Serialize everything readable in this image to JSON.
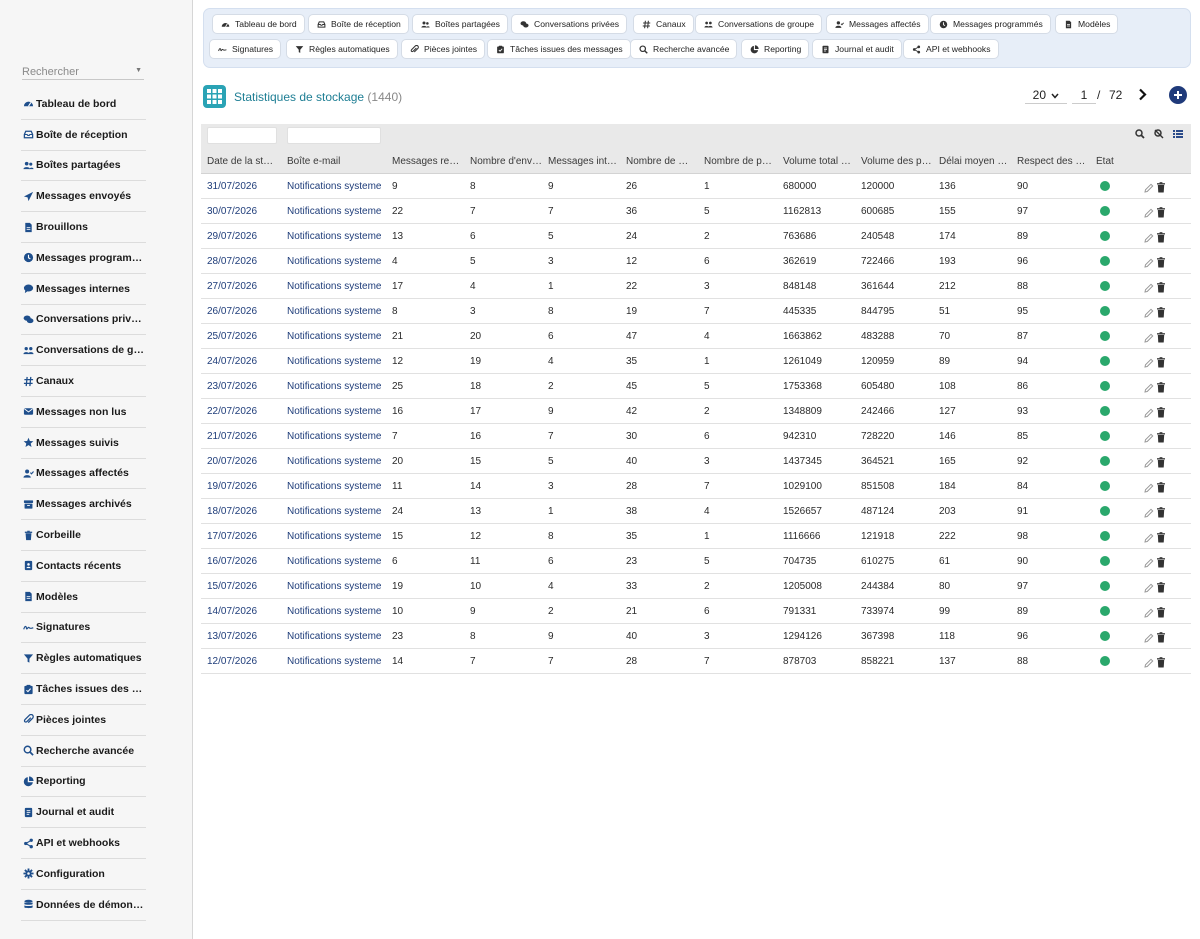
{
  "sidebar": {
    "search_placeholder": "Rechercher",
    "items": [
      {
        "label": "Tableau de bord",
        "icon": "dashboard-icon"
      },
      {
        "label": "Boîte de réception",
        "icon": "inbox-icon"
      },
      {
        "label": "Boîtes partagées",
        "icon": "users-icon"
      },
      {
        "label": "Messages envoyés",
        "icon": "send-icon"
      },
      {
        "label": "Brouillons",
        "icon": "file-icon"
      },
      {
        "label": "Messages programmés",
        "icon": "clock-icon"
      },
      {
        "label": "Messages internes",
        "icon": "comment-icon"
      },
      {
        "label": "Conversations privées",
        "icon": "comments-icon"
      },
      {
        "label": "Conversations de groupe",
        "icon": "group-icon"
      },
      {
        "label": "Canaux",
        "icon": "hash-icon"
      },
      {
        "label": "Messages non lus",
        "icon": "envelope-icon"
      },
      {
        "label": "Messages suivis",
        "icon": "star-icon"
      },
      {
        "label": "Messages affectés",
        "icon": "user-check-icon"
      },
      {
        "label": "Messages archivés",
        "icon": "archive-icon"
      },
      {
        "label": "Corbeille",
        "icon": "trash-icon"
      },
      {
        "label": "Contacts récents",
        "icon": "contact-icon"
      },
      {
        "label": "Modèles",
        "icon": "file-icon"
      },
      {
        "label": "Signatures",
        "icon": "signature-icon"
      },
      {
        "label": "Règles automatiques",
        "icon": "filter-icon"
      },
      {
        "label": "Tâches issues des messages",
        "icon": "tasks-icon"
      },
      {
        "label": "Pièces jointes",
        "icon": "paperclip-icon"
      },
      {
        "label": "Recherche avancée",
        "icon": "search-icon"
      },
      {
        "label": "Reporting",
        "icon": "pie-chart-icon"
      },
      {
        "label": "Journal et audit",
        "icon": "journal-icon"
      },
      {
        "label": "API et webhooks",
        "icon": "share-icon"
      },
      {
        "label": "Configuration",
        "icon": "gear-icon"
      },
      {
        "label": "Données de démonstration",
        "icon": "database-icon"
      }
    ]
  },
  "topbar": {
    "chips": [
      {
        "label": "Tableau de bord",
        "icon": "dashboard-icon"
      },
      {
        "label": "Boîte de réception",
        "icon": "inbox-icon"
      },
      {
        "label": "Boîtes partagées",
        "icon": "users-icon"
      },
      {
        "label": "Conversations privées",
        "icon": "comments-icon"
      },
      {
        "label": "Canaux",
        "icon": "hash-icon"
      },
      {
        "label": "Conversations de groupe",
        "icon": "group-icon"
      },
      {
        "label": "Messages affectés",
        "icon": "user-check-icon"
      },
      {
        "label": "Messages programmés",
        "icon": "clock-icon"
      },
      {
        "label": "Modèles",
        "icon": "file-icon"
      },
      {
        "label": "Signatures",
        "icon": "signature-icon"
      },
      {
        "label": "Règles automatiques",
        "icon": "filter-icon"
      },
      {
        "label": "Pièces jointes",
        "icon": "paperclip-icon"
      },
      {
        "label": "Tâches issues des messages",
        "icon": "tasks-icon"
      },
      {
        "label": "Recherche avancée",
        "icon": "search-icon"
      },
      {
        "label": "Reporting",
        "icon": "pie-chart-icon"
      },
      {
        "label": "Journal et audit",
        "icon": "journal-icon"
      },
      {
        "label": "API et webhooks",
        "icon": "share-icon"
      }
    ]
  },
  "page": {
    "title": "Statistiques de stockage",
    "count": "(1440)",
    "page_size": "20",
    "current_page": "1",
    "separator": "/",
    "total_pages": "72"
  },
  "table": {
    "columns": [
      "Date de la statistique",
      "Boîte e-mail",
      "Messages reçus",
      "Nombre d'envois",
      "Messages internes",
      "Nombre de conversations",
      "Nombre de pièces jointes",
      "Volume total stocké",
      "Volume des pièces jointes",
      "Délai moyen de réponse",
      "Respect des délais",
      "État"
    ],
    "rows": [
      [
        "31/07/2026",
        "Notifications systeme",
        "9",
        "8",
        "9",
        "26",
        "1",
        "680000",
        "120000",
        "136",
        "90"
      ],
      [
        "30/07/2026",
        "Notifications systeme",
        "22",
        "7",
        "7",
        "36",
        "5",
        "1162813",
        "600685",
        "155",
        "97"
      ],
      [
        "29/07/2026",
        "Notifications systeme",
        "13",
        "6",
        "5",
        "24",
        "2",
        "763686",
        "240548",
        "174",
        "89"
      ],
      [
        "28/07/2026",
        "Notifications systeme",
        "4",
        "5",
        "3",
        "12",
        "6",
        "362619",
        "722466",
        "193",
        "96"
      ],
      [
        "27/07/2026",
        "Notifications systeme",
        "17",
        "4",
        "1",
        "22",
        "3",
        "848148",
        "361644",
        "212",
        "88"
      ],
      [
        "26/07/2026",
        "Notifications systeme",
        "8",
        "3",
        "8",
        "19",
        "7",
        "445335",
        "844795",
        "51",
        "95"
      ],
      [
        "25/07/2026",
        "Notifications systeme",
        "21",
        "20",
        "6",
        "47",
        "4",
        "1663862",
        "483288",
        "70",
        "87"
      ],
      [
        "24/07/2026",
        "Notifications systeme",
        "12",
        "19",
        "4",
        "35",
        "1",
        "1261049",
        "120959",
        "89",
        "94"
      ],
      [
        "23/07/2026",
        "Notifications systeme",
        "25",
        "18",
        "2",
        "45",
        "5",
        "1753368",
        "605480",
        "108",
        "86"
      ],
      [
        "22/07/2026",
        "Notifications systeme",
        "16",
        "17",
        "9",
        "42",
        "2",
        "1348809",
        "242466",
        "127",
        "93"
      ],
      [
        "21/07/2026",
        "Notifications systeme",
        "7",
        "16",
        "7",
        "30",
        "6",
        "942310",
        "728220",
        "146",
        "85"
      ],
      [
        "20/07/2026",
        "Notifications systeme",
        "20",
        "15",
        "5",
        "40",
        "3",
        "1437345",
        "364521",
        "165",
        "92"
      ],
      [
        "19/07/2026",
        "Notifications systeme",
        "11",
        "14",
        "3",
        "28",
        "7",
        "1029100",
        "851508",
        "184",
        "84"
      ],
      [
        "18/07/2026",
        "Notifications systeme",
        "24",
        "13",
        "1",
        "38",
        "4",
        "1526657",
        "487124",
        "203",
        "91"
      ],
      [
        "17/07/2026",
        "Notifications systeme",
        "15",
        "12",
        "8",
        "35",
        "1",
        "1116666",
        "121918",
        "222",
        "98"
      ],
      [
        "16/07/2026",
        "Notifications systeme",
        "6",
        "11",
        "6",
        "23",
        "5",
        "704735",
        "610275",
        "61",
        "90"
      ],
      [
        "15/07/2026",
        "Notifications systeme",
        "19",
        "10",
        "4",
        "33",
        "2",
        "1205008",
        "244384",
        "80",
        "97"
      ],
      [
        "14/07/2026",
        "Notifications systeme",
        "10",
        "9",
        "2",
        "21",
        "6",
        "791331",
        "733974",
        "99",
        "89"
      ],
      [
        "13/07/2026",
        "Notifications systeme",
        "23",
        "8",
        "9",
        "40",
        "3",
        "1294126",
        "367398",
        "118",
        "96"
      ],
      [
        "12/07/2026",
        "Notifications systeme",
        "14",
        "7",
        "7",
        "28",
        "7",
        "878703",
        "858221",
        "137",
        "88"
      ]
    ]
  },
  "colors": {
    "accent": "#1e7e94",
    "link": "#1f3d7a",
    "status_ok": "#2aa86c",
    "brand_navy": "#1f3a7a"
  }
}
